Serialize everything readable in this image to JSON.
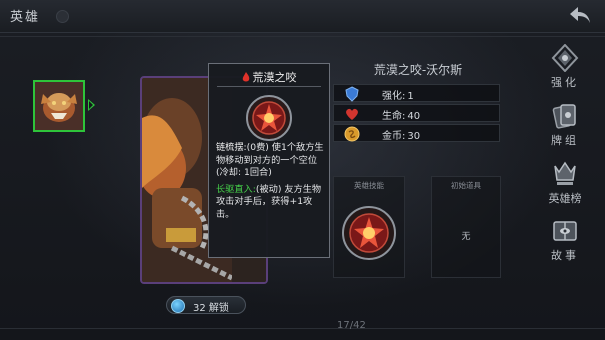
{
  "topbar": {
    "title": "英雄",
    "back_icon": "back-arrow-icon"
  },
  "tooltip": {
    "title": "荒漠之咬",
    "abilities": [
      {
        "name": "链梳摆:",
        "text": "(0费) 使1个敌方生物移动到对方的一个空位 (冷却: 1回合)"
      },
      {
        "name": "长驱直入:",
        "text": "(被动) 友方生物攻击对手后，获得+1攻击。"
      }
    ]
  },
  "unlock": {
    "label": "32 解锁"
  },
  "pager": {
    "label": "17/42"
  },
  "hero": {
    "name": "荒漠之咬-沃尔斯",
    "stats": [
      {
        "label": "强化:",
        "value": "1",
        "icon": "shield-icon",
        "color": "#3b7bd6"
      },
      {
        "label": "生命:",
        "value": "40",
        "icon": "heart-icon",
        "color": "#d2352f"
      },
      {
        "label": "金币:",
        "value": "30",
        "icon": "coin-icon",
        "color": "#d99a2b"
      }
    ]
  },
  "panels": {
    "skills_title": "英雄技能",
    "items_title": "初始道具",
    "items_empty": "无"
  },
  "menu": [
    {
      "label": "强化",
      "icon": "upgrade-icon"
    },
    {
      "label": "牌组",
      "icon": "card-deck-icon"
    },
    {
      "label": "英雄榜",
      "icon": "hero-list-icon"
    },
    {
      "label": "故事",
      "icon": "story-icon"
    }
  ],
  "colors": {
    "selection": "#2ec43a",
    "card_border": "#5a3f7a",
    "highlight_green": "#46d24a"
  }
}
